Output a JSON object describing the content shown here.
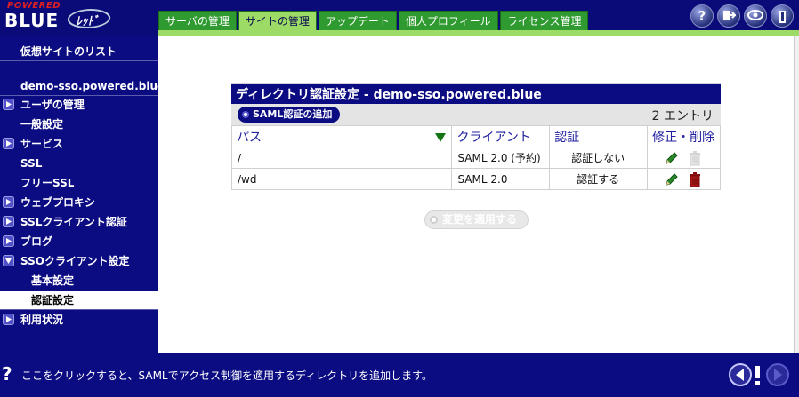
{
  "header": {
    "logo_top": "POWERED",
    "logo_main": "BLUE",
    "logo_mark": "ﾚｯﾄﾞ",
    "tabs": [
      "サーバの管理",
      "サイトの管理",
      "アップデート",
      "個人プロフィール",
      "ライセンス管理"
    ],
    "active_tab": 1,
    "help_label": "?",
    "icons": [
      "help-icon",
      "logout-icon",
      "eye-icon",
      "exit-door-icon"
    ]
  },
  "sidebar": {
    "items": [
      {
        "label": "仮想サイトのリスト",
        "expander": null
      },
      {
        "label": "demo-sso.powered.blue",
        "expander": null
      },
      {
        "label": "ユーザの管理",
        "expander": "right"
      },
      {
        "label": "一般設定",
        "expander": null
      },
      {
        "label": "サービス",
        "expander": "right"
      },
      {
        "label": "SSL",
        "expander": null
      },
      {
        "label": "フリーSSL",
        "expander": null
      },
      {
        "label": "ウェブプロキシ",
        "expander": "right"
      },
      {
        "label": "SSLクライアント認証",
        "expander": "right"
      },
      {
        "label": "ブログ",
        "expander": "right"
      },
      {
        "label": "SSOクライアント設定",
        "expander": "down"
      },
      {
        "label": "基本設定",
        "expander": null
      },
      {
        "label": "認証設定",
        "expander": null
      },
      {
        "label": "利用状況",
        "expander": "right"
      }
    ],
    "selected": "認証設定"
  },
  "panel": {
    "title": "ディレクトリ認証設定 - demo-sso.powered.blue",
    "add_button": "SAML認証の追加",
    "entry_count": "2 エントリ",
    "columns": [
      "パス",
      "クライアント",
      "認証",
      "修正・削除"
    ],
    "rows": [
      {
        "path": "/",
        "client": "SAML 2.0 (予約)",
        "auth": "認証しない",
        "editable": true,
        "deletable": false
      },
      {
        "path": "/wd",
        "client": "SAML 2.0",
        "auth": "認証する",
        "editable": true,
        "deletable": true
      }
    ],
    "apply_button": "変更を適用する"
  },
  "footer": {
    "help_mark": "?",
    "help_text": "ここをクリックすると、SAMLでアクセス制御を適用するディレクトリを追加します。"
  },
  "colors": {
    "navy": "#0b0b82",
    "tab_green": "#2f9a2f",
    "tab_active": "#9cdc66",
    "edit_green": "#2a8a2a",
    "delete_red": "#b01818"
  }
}
